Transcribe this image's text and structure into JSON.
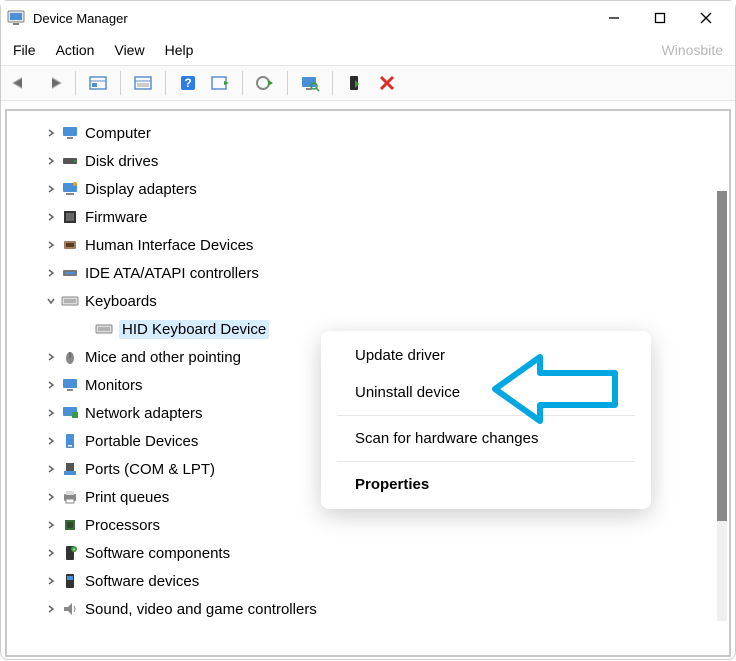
{
  "titlebar": {
    "title": "Device Manager"
  },
  "menubar": {
    "items": [
      "File",
      "Action",
      "View",
      "Help"
    ],
    "watermark": "Winosbite"
  },
  "tree": {
    "nodes": [
      {
        "label": "Computer",
        "icon": "computer",
        "level": 1,
        "expander": "right",
        "selected": false
      },
      {
        "label": "Disk drives",
        "icon": "disk",
        "level": 1,
        "expander": "right",
        "selected": false
      },
      {
        "label": "Display adapters",
        "icon": "display",
        "level": 1,
        "expander": "right",
        "selected": false
      },
      {
        "label": "Firmware",
        "icon": "firmware",
        "level": 1,
        "expander": "right",
        "selected": false
      },
      {
        "label": "Human Interface Devices",
        "icon": "hid",
        "level": 1,
        "expander": "right",
        "selected": false
      },
      {
        "label": "IDE ATA/ATAPI controllers",
        "icon": "ide",
        "level": 1,
        "expander": "right",
        "selected": false
      },
      {
        "label": "Keyboards",
        "icon": "keyboard",
        "level": 1,
        "expander": "down",
        "selected": false
      },
      {
        "label": "HID Keyboard Device",
        "icon": "keyboard",
        "level": 2,
        "expander": "none",
        "selected": true
      },
      {
        "label": "Mice and other pointing",
        "icon": "mouse",
        "level": 1,
        "expander": "right",
        "selected": false
      },
      {
        "label": "Monitors",
        "icon": "monitor",
        "level": 1,
        "expander": "right",
        "selected": false
      },
      {
        "label": "Network adapters",
        "icon": "network",
        "level": 1,
        "expander": "right",
        "selected": false
      },
      {
        "label": "Portable Devices",
        "icon": "portable",
        "level": 1,
        "expander": "right",
        "selected": false
      },
      {
        "label": "Ports (COM & LPT)",
        "icon": "port",
        "level": 1,
        "expander": "right",
        "selected": false
      },
      {
        "label": "Print queues",
        "icon": "printer",
        "level": 1,
        "expander": "right",
        "selected": false
      },
      {
        "label": "Processors",
        "icon": "cpu",
        "level": 1,
        "expander": "right",
        "selected": false
      },
      {
        "label": "Software components",
        "icon": "swcomp",
        "level": 1,
        "expander": "right",
        "selected": false
      },
      {
        "label": "Software devices",
        "icon": "swdev",
        "level": 1,
        "expander": "right",
        "selected": false
      },
      {
        "label": "Sound, video and game controllers",
        "icon": "sound",
        "level": 1,
        "expander": "right",
        "selected": false
      }
    ]
  },
  "context_menu": {
    "items": [
      {
        "label": "Update driver",
        "bold": false
      },
      {
        "label": "Uninstall device",
        "bold": false
      },
      {
        "sep": true
      },
      {
        "label": "Scan for hardware changes",
        "bold": false
      },
      {
        "sep": true
      },
      {
        "label": "Properties",
        "bold": true
      }
    ]
  }
}
